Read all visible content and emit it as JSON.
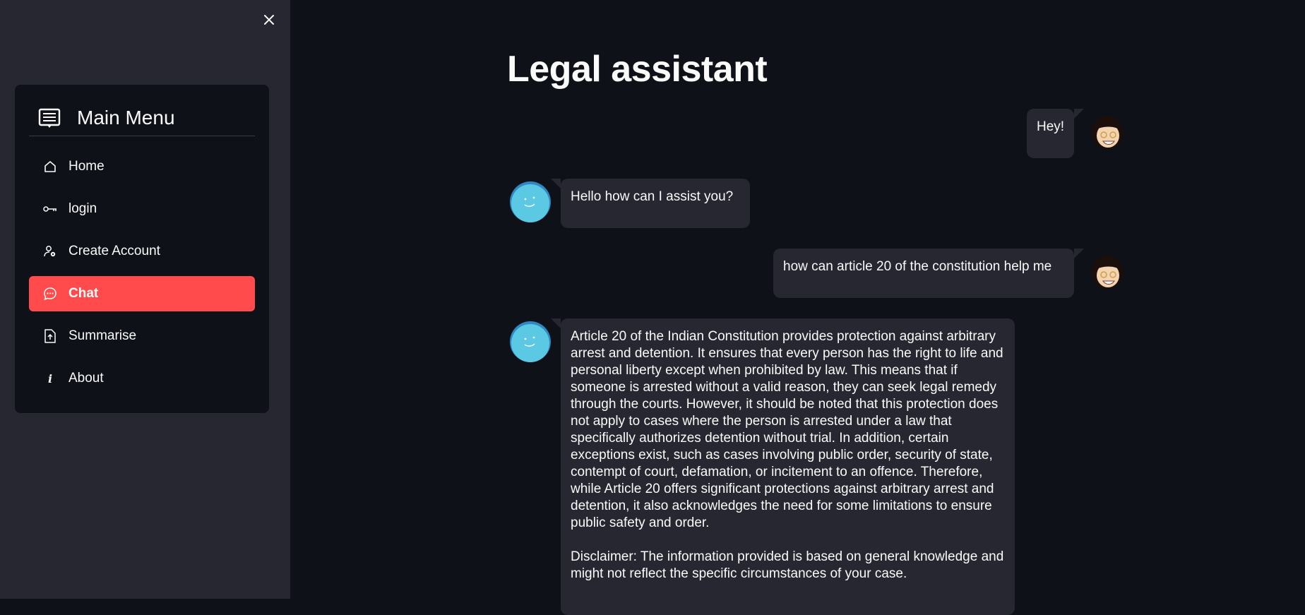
{
  "sidebar": {
    "close_icon": "close-icon",
    "menu_title": "Main Menu",
    "menu_icon": "menu-list-icon",
    "items": [
      {
        "label": "Home",
        "icon": "home-icon"
      },
      {
        "label": "login",
        "icon": "key-icon"
      },
      {
        "label": "Create Account",
        "icon": "person-gear-icon"
      },
      {
        "label": "Chat",
        "icon": "chat-dots-icon",
        "active": true
      },
      {
        "label": "Summarise",
        "icon": "file-upload-icon"
      },
      {
        "label": "About",
        "icon": "info-icon"
      }
    ]
  },
  "colors": {
    "background": "#0e1117",
    "sidebar": "#262730",
    "accent": "#ff4b4b",
    "bubble": "#262730",
    "bot_avatar": "#5bc9e3"
  },
  "main": {
    "title": "Legal assistant",
    "messages": [
      {
        "role": "user",
        "text": "Hey!"
      },
      {
        "role": "assistant",
        "text": "Hello how can I assist you?"
      },
      {
        "role": "user",
        "text": "how can article 20 of the constitution help me"
      },
      {
        "role": "assistant",
        "text": "Article 20 of the Indian Constitution provides protection against arbitrary arrest and detention. It ensures that every person has the right to life and personal liberty except when prohibited by law. This means that if someone is arrested without a valid reason, they can seek legal remedy through the courts. However, it should be noted that this protection does not apply to cases where the person is arrested under a law that specifically authorizes detention without trial. In addition, certain exceptions exist, such as cases involving public order, security of state, contempt of court, defamation, or incitement to an offence. Therefore, while Article 20 offers significant protections against arbitrary arrest and detention, it also acknowledges the need for some limitations to ensure public safety and order.\n\nDisclaimer: The information provided is based on general knowledge and might not reflect the specific circumstances of your case."
      }
    ]
  }
}
